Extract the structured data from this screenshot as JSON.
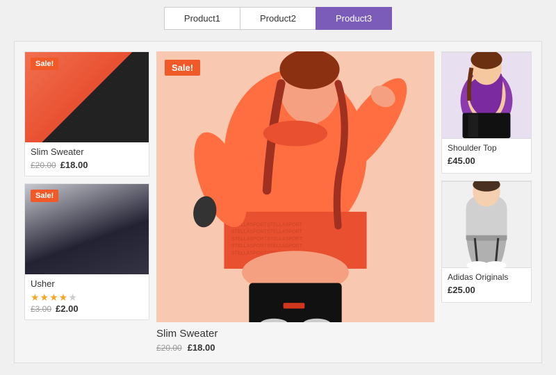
{
  "tabs": [
    {
      "label": "Product1",
      "active": false
    },
    {
      "label": "Product2",
      "active": false
    },
    {
      "label": "Product3",
      "active": true
    }
  ],
  "left_products": [
    {
      "name": "Slim Sweater",
      "sale": true,
      "sale_label": "Sale!",
      "price_old": "£20.00",
      "price_new": "£18.00",
      "has_stars": false
    },
    {
      "name": "Usher",
      "sale": true,
      "sale_label": "Sale!",
      "price_old": "£3.00",
      "price_new": "£2.00",
      "has_stars": true,
      "stars": 4
    }
  ],
  "featured": {
    "sale_label": "Sale!",
    "name": "Slim Sweater",
    "price_old": "£20.00",
    "price_new": "£18.00"
  },
  "right_products": [
    {
      "name": "Shoulder Top",
      "price": "£45.00"
    },
    {
      "name": "Adidas Originals",
      "price": "£25.00"
    }
  ],
  "colors": {
    "active_tab": "#7b5cb8",
    "sale_badge": "#f05a28"
  }
}
